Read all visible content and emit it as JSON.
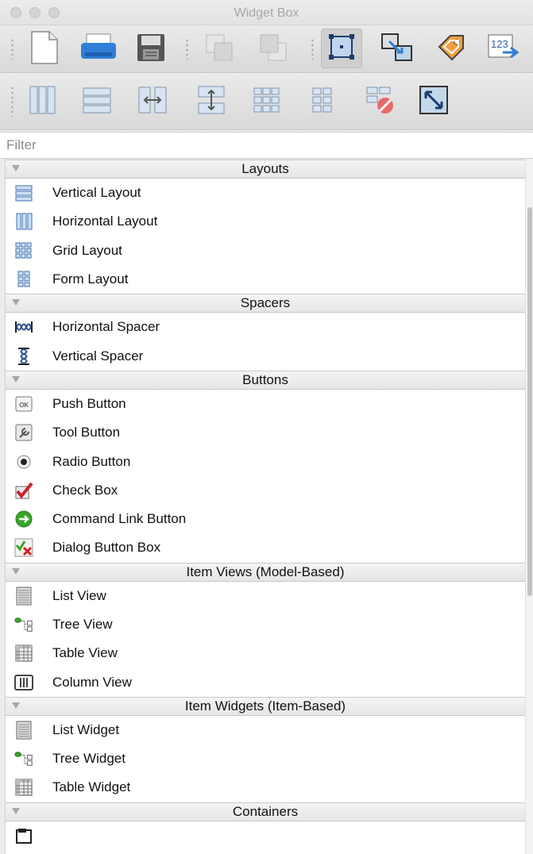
{
  "window": {
    "title": "Widget Box"
  },
  "filter": {
    "placeholder": "Filter"
  },
  "toolbar_row1": [
    {
      "icon": "new-form-icon"
    },
    {
      "icon": "print-icon"
    },
    {
      "icon": "save-icon"
    },
    {
      "icon": "send-to-back-icon"
    },
    {
      "icon": "bring-to-front-icon"
    },
    {
      "icon": "edit-widgets-icon"
    },
    {
      "icon": "edit-signals-slots-icon"
    },
    {
      "icon": "edit-buddies-icon"
    },
    {
      "icon": "edit-tab-order-icon"
    }
  ],
  "toolbar_row2": [
    {
      "icon": "layout-horizontal-icon"
    },
    {
      "icon": "layout-vertical-icon"
    },
    {
      "icon": "layout-horizontal-splitter-icon"
    },
    {
      "icon": "layout-vertical-splitter-icon"
    },
    {
      "icon": "layout-grid-icon"
    },
    {
      "icon": "layout-form-icon"
    },
    {
      "icon": "break-layout-icon"
    },
    {
      "icon": "adjust-size-icon"
    }
  ],
  "categories": [
    {
      "label": "Layouts",
      "items": [
        {
          "label": "Vertical Layout",
          "icon": "vertical-layout-icon"
        },
        {
          "label": "Horizontal Layout",
          "icon": "horizontal-layout-icon"
        },
        {
          "label": "Grid Layout",
          "icon": "grid-layout-icon"
        },
        {
          "label": "Form Layout",
          "icon": "form-layout-icon"
        }
      ]
    },
    {
      "label": "Spacers",
      "items": [
        {
          "label": "Horizontal Spacer",
          "icon": "horizontal-spacer-icon"
        },
        {
          "label": "Vertical Spacer",
          "icon": "vertical-spacer-icon"
        }
      ]
    },
    {
      "label": "Buttons",
      "items": [
        {
          "label": "Push Button",
          "icon": "push-button-icon",
          "glyph": "OK"
        },
        {
          "label": "Tool Button",
          "icon": "tool-button-icon"
        },
        {
          "label": "Radio Button",
          "icon": "radio-button-icon"
        },
        {
          "label": "Check Box",
          "icon": "check-box-icon"
        },
        {
          "label": "Command Link Button",
          "icon": "command-link-icon"
        },
        {
          "label": "Dialog Button Box",
          "icon": "dialog-button-box-icon"
        }
      ]
    },
    {
      "label": "Item Views (Model-Based)",
      "items": [
        {
          "label": "List View",
          "icon": "list-view-icon"
        },
        {
          "label": "Tree View",
          "icon": "tree-view-icon"
        },
        {
          "label": "Table View",
          "icon": "table-view-icon"
        },
        {
          "label": "Column View",
          "icon": "column-view-icon"
        }
      ]
    },
    {
      "label": "Item Widgets (Item-Based)",
      "items": [
        {
          "label": "List Widget",
          "icon": "list-widget-icon"
        },
        {
          "label": "Tree Widget",
          "icon": "tree-widget-icon"
        },
        {
          "label": "Table Widget",
          "icon": "table-widget-icon"
        }
      ]
    },
    {
      "label": "Containers",
      "items": [
        {
          "label": "",
          "icon": "group-box-icon"
        }
      ]
    }
  ],
  "colors": {
    "accent_blue": "#2f7fd8",
    "check_red": "#c8202a",
    "link_green": "#3aa52a"
  }
}
